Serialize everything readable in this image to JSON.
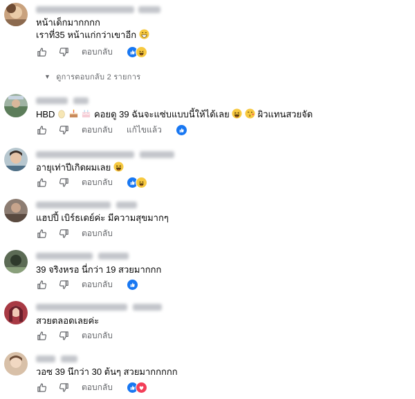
{
  "reply_label": "ตอบกลับ",
  "edited_label": "แก้ไขแล้ว",
  "view_replies": "ดูการตอบกลับ 2 รายการ",
  "colors": {
    "like": "#1877f2",
    "haha": "#f7c940",
    "love": "#f33e58",
    "muted": "#65676b"
  },
  "comments": [
    {
      "lines": [
        "หน้าเด็กมากกกก",
        "เราที่35 หน้าแก่กว่าเขาอีก"
      ],
      "reactions": [
        "like",
        "haha"
      ]
    },
    {
      "lines": [
        "HBD",
        "คอยดู 39 ฉันจะแซ่บแบบนี้ให้ได้เลย",
        "ผิวแทนสวยจัด"
      ],
      "reactions": [
        "like"
      ],
      "edited": true
    },
    {
      "lines": [
        "อายุเท่าปีเกิดผมเลย"
      ],
      "reactions": [
        "like",
        "haha"
      ]
    },
    {
      "lines": [
        "แฮปปี้ เบิร์ธเดย์ค่ะ มีความสุขมากๆ"
      ],
      "reactions": []
    },
    {
      "lines": [
        "39 จริงหรอ นี่กว่า 19 สวยมากกก"
      ],
      "reactions": [
        "like"
      ]
    },
    {
      "lines": [
        "สวยตลอดเลยค่ะ"
      ],
      "reactions": []
    },
    {
      "lines": [
        "วอซ 39 นึกว่า 30 ต้นๆ สวยมากกกกก"
      ],
      "reactions": [
        "like",
        "love"
      ]
    }
  ]
}
